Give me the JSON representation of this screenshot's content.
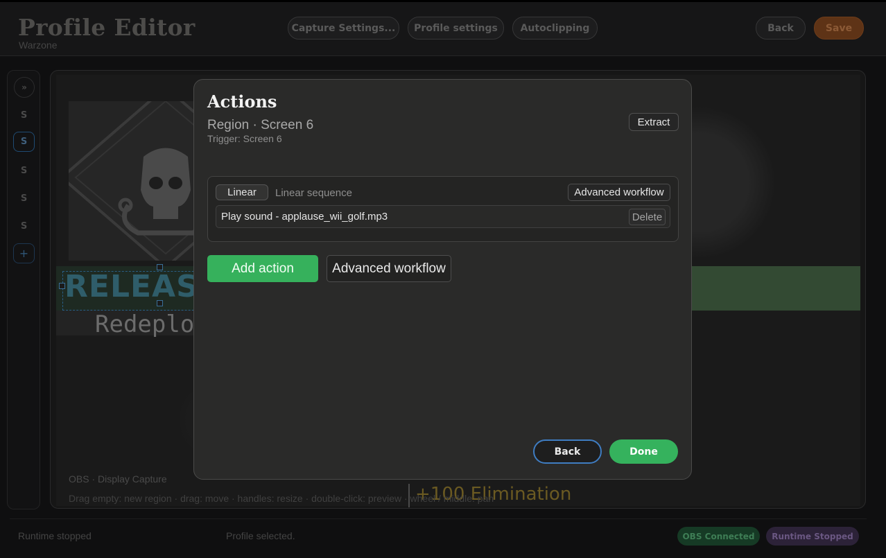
{
  "header": {
    "title": "Profile Editor",
    "subtitle": "Warzone",
    "buttons": {
      "capture_settings": "Capture Settings...",
      "profile_settings": "Profile settings",
      "autoclipping": "Autoclipping",
      "back": "Back",
      "save": "Save"
    }
  },
  "rail": {
    "collapse_icon": "»",
    "screens": [
      "S",
      "S",
      "S",
      "S",
      "S"
    ],
    "active_index": 1,
    "add_label": "+"
  },
  "preview": {
    "release_text": "RELEAS",
    "redeploy_text": "Redeployi",
    "elimination_text": "+100 Elimination",
    "source_label": "OBS · Display Capture",
    "hint": "Drag empty: new region · drag: move · handles: resize · double-click: preview · wheel / middle: pan"
  },
  "modal": {
    "title": "Actions",
    "subtitle": "Region · Screen 6",
    "trigger": "Trigger: Screen 6",
    "extract_label": "Extract",
    "sequence": {
      "mode_label": "Linear",
      "mode_description": "Linear sequence",
      "advanced_label": "Advanced workflow",
      "actions": [
        {
          "label": "Play sound - applause_wii_golf.mp3",
          "delete_label": "Delete"
        }
      ]
    },
    "add_action_label": "Add action",
    "advanced_workflow_label": "Advanced workflow",
    "back_label": "Back",
    "done_label": "Done"
  },
  "status": {
    "left": "Runtime stopped",
    "middle": "Profile selected.",
    "obs_pill": "OBS Connected",
    "runtime_pill": "Runtime Stopped"
  },
  "colors": {
    "accent_green": "#36b15c",
    "save_orange": "#5e3316",
    "back_outline_blue": "#3f7dc2"
  }
}
